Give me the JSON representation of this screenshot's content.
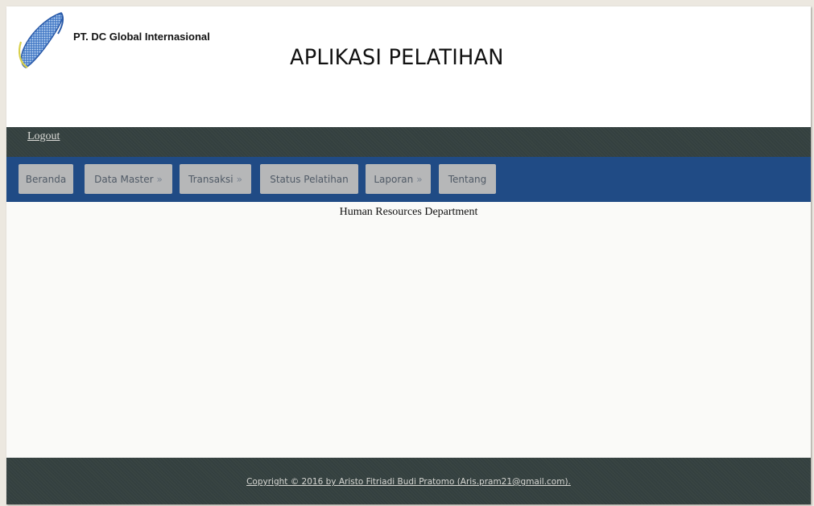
{
  "header": {
    "company_name": "PT. DC Global Internasional",
    "app_title": "APLIKASI PELATIHAN"
  },
  "topbar": {
    "logout_label": "Logout"
  },
  "nav": {
    "items": [
      {
        "label": "Beranda",
        "arrow": ""
      },
      {
        "label": "Data Master",
        "arrow": "»"
      },
      {
        "label": "Transaksi",
        "arrow": "»"
      },
      {
        "label": "Status Pelatihan",
        "arrow": ""
      },
      {
        "label": "Laporan",
        "arrow": "»"
      },
      {
        "label": "Tentang",
        "arrow": ""
      }
    ]
  },
  "content": {
    "department": "Human Resources Department"
  },
  "footer": {
    "copyright": "Copyright © 2016 by Aristo Fitriadi Budi Pratomo (Aris.pram21@gmail.com)."
  },
  "colors": {
    "nav_bar": "#204b85",
    "dark_bar": "#34403f",
    "nav_button": "#b6b7b8"
  }
}
